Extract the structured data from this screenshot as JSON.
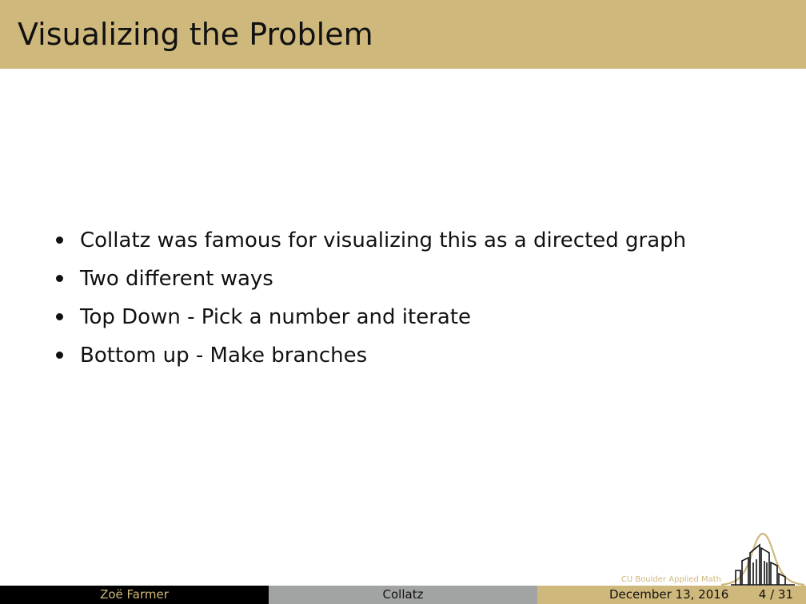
{
  "slide": {
    "title": "Visualizing the Problem",
    "bullets": [
      "Collatz was famous for visualizing this as a directed graph",
      "Two different ways",
      "Top Down - Pick a number and iterate",
      "Bottom up - Make branches"
    ]
  },
  "logo": {
    "caption": "CU Boulder Applied Math"
  },
  "footer": {
    "author": "Zoë Farmer",
    "title": "Collatz",
    "date": "December 13, 2016",
    "page": "4 / 31"
  },
  "colors": {
    "gold": "#cfb87c",
    "black": "#000000",
    "gray": "#a2a4a3"
  }
}
